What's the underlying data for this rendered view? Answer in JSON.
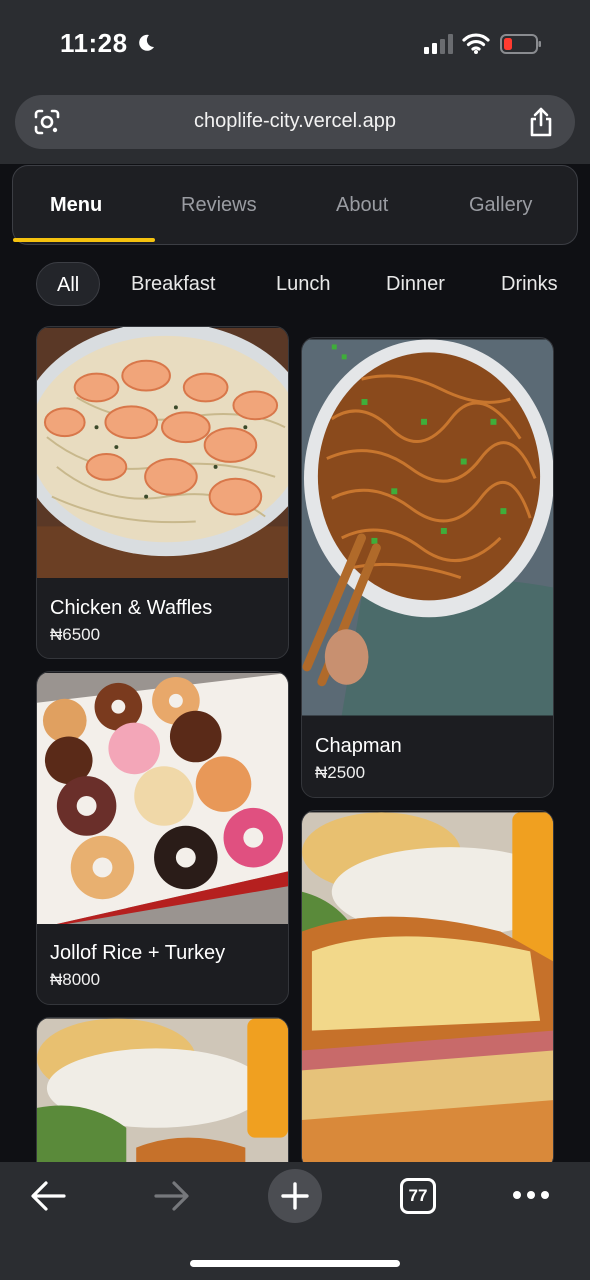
{
  "status": {
    "time": "11:28"
  },
  "browser": {
    "url": "choplife-city.vercel.app",
    "tab_count": "77"
  },
  "nav": {
    "tabs": [
      {
        "label": "Menu"
      },
      {
        "label": "Reviews"
      },
      {
        "label": "About"
      },
      {
        "label": "Gallery"
      }
    ],
    "active_tab": "Menu"
  },
  "filters": {
    "items": [
      {
        "label": "All"
      },
      {
        "label": "Breakfast"
      },
      {
        "label": "Lunch"
      },
      {
        "label": "Dinner"
      },
      {
        "label": "Drinks"
      }
    ],
    "active": "All"
  },
  "menu_items": [
    {
      "name": "Chicken & Waffles",
      "price": "₦6500"
    },
    {
      "name": "Chapman",
      "price": "₦2500"
    },
    {
      "name": "Jollof Rice + Turkey",
      "price": "₦8000"
    },
    {
      "name": "",
      "price": ""
    },
    {
      "name": "",
      "price": ""
    }
  ],
  "colors": {
    "accent": "#f5c20f",
    "background": "#0f1014",
    "card": "#1c1d21"
  }
}
